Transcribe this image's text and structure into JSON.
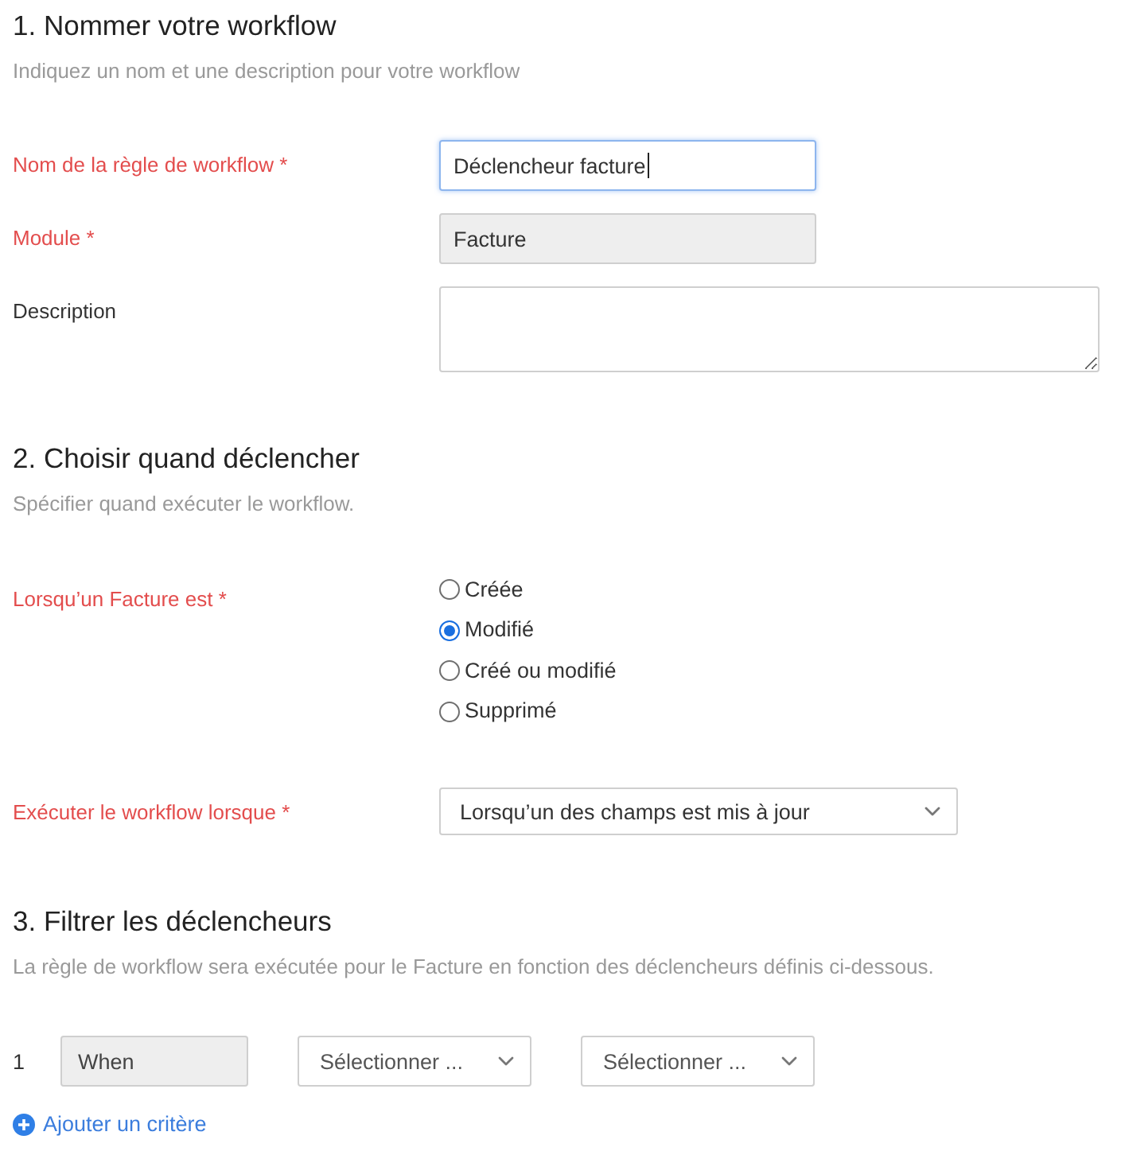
{
  "sections": [
    {
      "title": "1. Nommer votre workflow",
      "subtitle": "Indiquez un nom et une description pour votre workflow",
      "fields": [
        {
          "kind": "text",
          "label": "Nom de la règle de workflow *",
          "required": true,
          "value": "Déclencheur facture",
          "focused": true,
          "disabled": false
        },
        {
          "kind": "text",
          "label": "Module *",
          "required": true,
          "value": "Facture",
          "focused": false,
          "disabled": true
        },
        {
          "kind": "textarea",
          "label": "Description",
          "required": false,
          "focused": false,
          "disabled": false
        }
      ]
    },
    {
      "title": "2. Choisir quand déclencher",
      "subtitle": "Spécifier quand exécuter le workflow.",
      "fields": [
        {
          "kind": "radio",
          "label": "Lorsqu’un Facture est *",
          "required": true,
          "options": [
            {
              "label": "Créée",
              "selected": false
            },
            {
              "label": "Modifié",
              "selected": true
            },
            {
              "label": "Créé ou modifié",
              "selected": false
            },
            {
              "label": "Supprimé",
              "selected": false
            }
          ]
        },
        {
          "kind": "select",
          "label": "Exécuter le workflow lorsque *",
          "required": true,
          "value": "Lorsqu’un des champs est mis à jour"
        }
      ]
    },
    {
      "title": "3. Filtrer les déclencheurs",
      "subtitle": "La règle de workflow sera exécutée pour le Facture en fonction des déclencheurs définis ci-dessous.",
      "criteria": [
        {
          "number": "1",
          "condition": "When",
          "selects": [
            {
              "placeholder": "Sélectionner ..."
            },
            {
              "placeholder": "Sélectionner ..."
            }
          ]
        }
      ],
      "add_link": "Ajouter un critère"
    }
  ]
}
